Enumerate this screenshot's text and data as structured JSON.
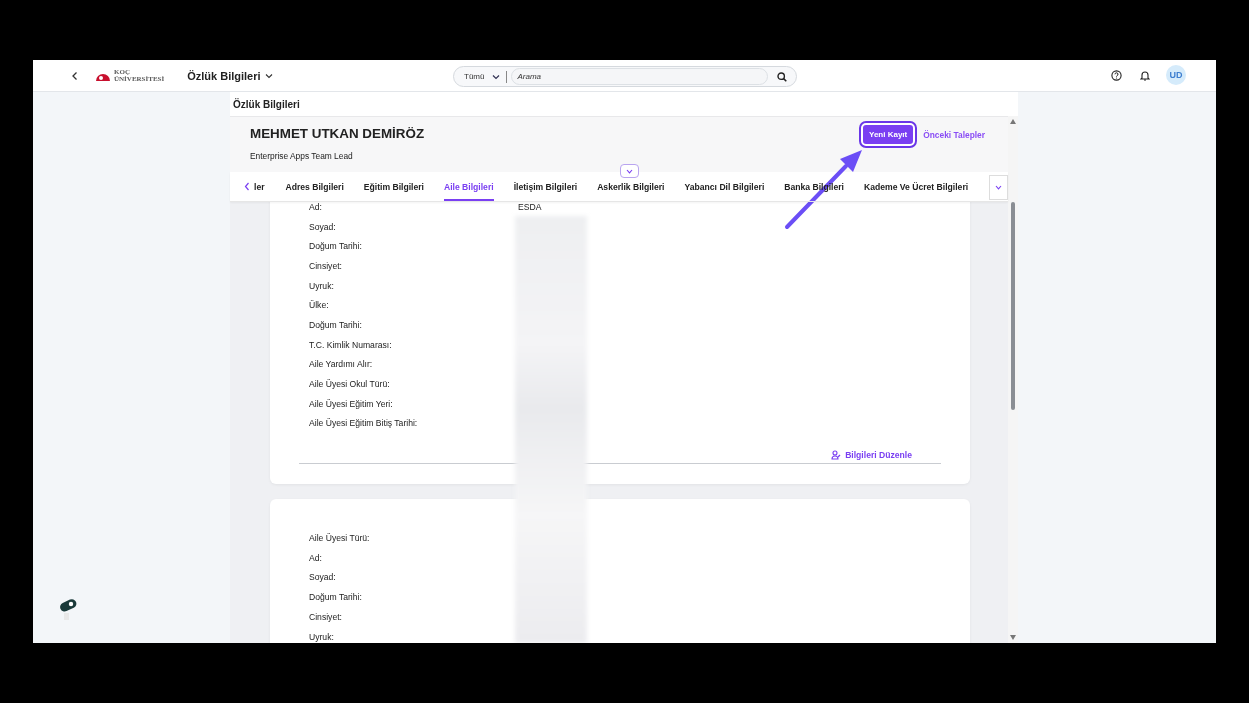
{
  "top_bar": {
    "logo": {
      "line1": "KOÇ",
      "line2": "ÜNİVERSİTESİ"
    },
    "app_title": "Özlük Bilgileri",
    "search": {
      "scope": "Tümü",
      "placeholder": "Arama"
    },
    "avatar": "UD"
  },
  "panel": {
    "title": "Özlük Bilgileri",
    "name": "MEHMET UTKAN DEMİRÖZ",
    "job_title": "Enterprise Apps Team Lead",
    "actions": [
      {
        "label": "Yeni Kayıt",
        "kind": "primary"
      },
      {
        "label": "Önceki Talepler",
        "kind": "link"
      }
    ]
  },
  "tabs": [
    {
      "label": "ler",
      "selected": false
    },
    {
      "label": "Adres Bilgileri",
      "selected": false
    },
    {
      "label": "Eğitim Bilgileri",
      "selected": false
    },
    {
      "label": "Aile Bilgileri",
      "selected": true
    },
    {
      "label": "İletişim Bilgileri",
      "selected": false
    },
    {
      "label": "Askerlik Bilgileri",
      "selected": false
    },
    {
      "label": "Yabancı Dil Bilgileri",
      "selected": false
    },
    {
      "label": "Banka Bilgileri",
      "selected": false
    },
    {
      "label": "Kademe Ve Ücret Bilgileri",
      "selected": false
    }
  ],
  "cards": [
    {
      "fields": [
        {
          "label": "Ad:",
          "value": "ESDA"
        },
        {
          "label": "Soyad:"
        },
        {
          "label": "Doğum Tarihi:"
        },
        {
          "label": "Cinsiyet:"
        },
        {
          "label": "Uyruk:"
        },
        {
          "label": "Ülke:"
        },
        {
          "label": "Doğum Tarihi:"
        },
        {
          "label": "T.C. Kimlik Numarası:"
        },
        {
          "label": "Aile Yardımı Alır:"
        },
        {
          "label": "Aile Üyesi Okul Türü:"
        },
        {
          "label": "Aile Üyesi Eğitim Yeri:"
        },
        {
          "label": "Aile Üyesi Eğitim Bitiş Tarihi:"
        }
      ],
      "edit_link": "Bilgileri Düzenle"
    },
    {
      "fields": [
        {
          "label": "Aile Üyesi Türü:"
        },
        {
          "label": "Ad:"
        },
        {
          "label": "Soyad:"
        },
        {
          "label": "Doğum Tarihi:"
        },
        {
          "label": "Cinsiyet:"
        },
        {
          "label": "Uyruk:"
        }
      ]
    }
  ]
}
